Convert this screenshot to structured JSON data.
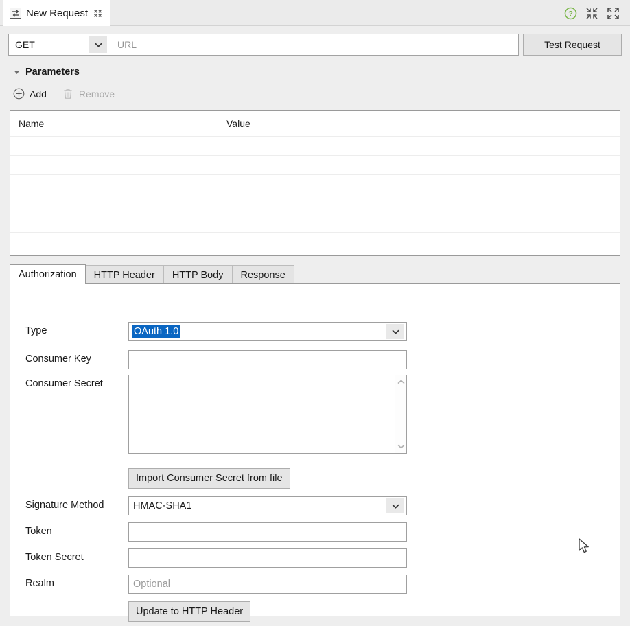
{
  "window": {
    "tab": {
      "title": "New Request",
      "icon": "request-exchange-icon",
      "close_icon": "close-icon"
    },
    "header_tools": [
      {
        "name": "help-icon",
        "label": "?",
        "color": "#7ab648"
      },
      {
        "name": "minimize-icon",
        "label": ""
      },
      {
        "name": "maximize-icon",
        "label": ""
      }
    ]
  },
  "request": {
    "method": "GET",
    "method_options": [
      "GET"
    ],
    "url_value": "",
    "url_placeholder": "URL",
    "test_button": "Test Request"
  },
  "parameters": {
    "section_title": "Parameters",
    "expanded": true,
    "toolbar": {
      "add_label": "Add",
      "add_icon": "plus-circle-icon",
      "remove_label": "Remove",
      "remove_icon": "trash-icon",
      "remove_enabled": false
    },
    "columns": [
      "Name",
      "Value"
    ],
    "rows": [
      {
        "name": "",
        "value": ""
      },
      {
        "name": "",
        "value": ""
      },
      {
        "name": "",
        "value": ""
      },
      {
        "name": "",
        "value": ""
      },
      {
        "name": "",
        "value": ""
      },
      {
        "name": "",
        "value": ""
      }
    ]
  },
  "tabs": {
    "items": [
      {
        "label": "Authorization",
        "active": true
      },
      {
        "label": "HTTP Header",
        "active": false
      },
      {
        "label": "HTTP Body",
        "active": false
      },
      {
        "label": "Response",
        "active": false
      }
    ]
  },
  "authorization": {
    "type_label": "Type",
    "type_value": "OAuth 1.0",
    "type_options": [
      "OAuth 1.0"
    ],
    "consumer_key_label": "Consumer Key",
    "consumer_key_value": "",
    "consumer_secret_label": "Consumer Secret",
    "consumer_secret_value": "",
    "import_button": "Import Consumer Secret from file",
    "signature_method_label": "Signature Method",
    "signature_method_value": "HMAC-SHA1",
    "signature_method_options": [
      "HMAC-SHA1"
    ],
    "token_label": "Token",
    "token_value": "",
    "token_secret_label": "Token Secret",
    "token_secret_value": "",
    "realm_label": "Realm",
    "realm_value": "",
    "realm_placeholder": "Optional",
    "update_button": "Update to HTTP Header"
  },
  "colors": {
    "selection_blue": "#0a66c2",
    "help_green": "#7ab648",
    "panel_bg": "#ffffff",
    "chrome_bg": "#ebebeb",
    "button_bg": "#e5e5e5"
  }
}
